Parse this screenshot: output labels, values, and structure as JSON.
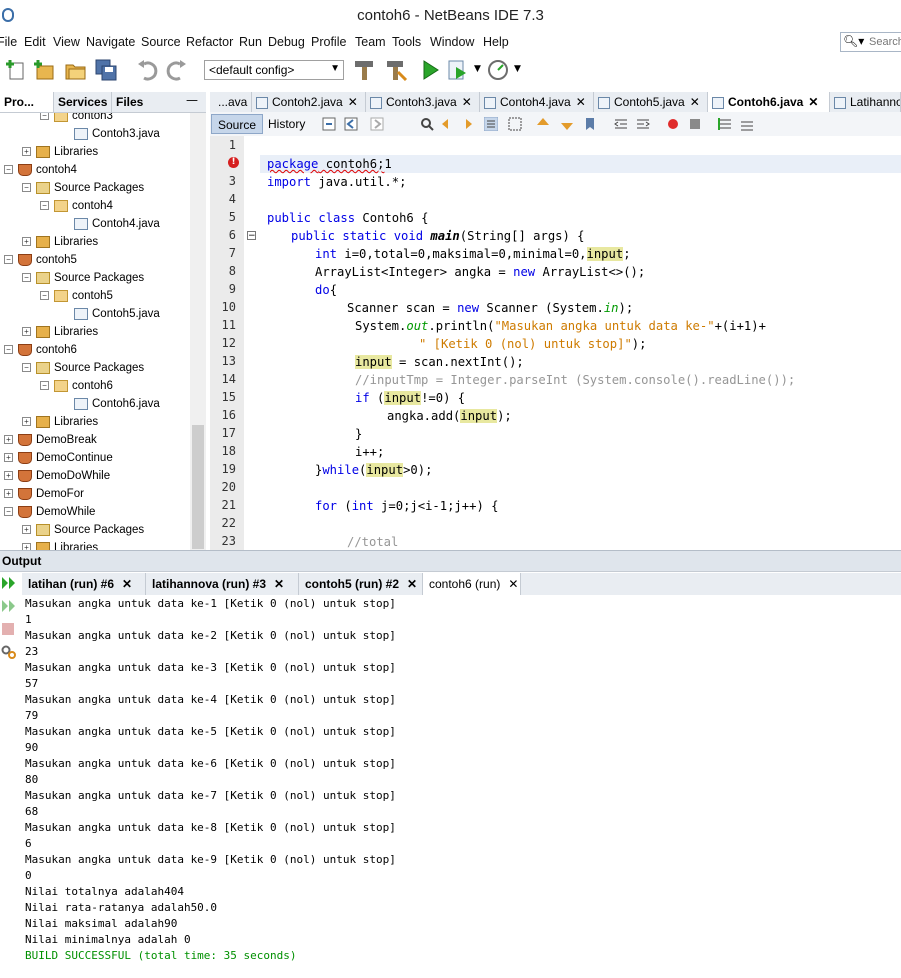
{
  "window": {
    "title": "contoh6 - NetBeans IDE 7.3"
  },
  "menubar": {
    "items": [
      "File",
      "Edit",
      "View",
      "Navigate",
      "Source",
      "Refactor",
      "Run",
      "Debug",
      "Profile",
      "Team",
      "Tools",
      "Window",
      "Help"
    ],
    "search_placeholder": "Search"
  },
  "toolbar": {
    "config": "<default config>"
  },
  "projects": {
    "tabs": [
      "Pro...",
      "Services",
      "Files"
    ],
    "minimize": "—",
    "tree": [
      {
        "label": "contoh3",
        "icon": "package-icon",
        "level": 2,
        "toggle": "−"
      },
      {
        "label": "Contoh3.java",
        "icon": "java-file-icon",
        "level": 3,
        "toggle": ""
      },
      {
        "label": "Libraries",
        "icon": "library-icon",
        "level": 1,
        "toggle": "+"
      },
      {
        "label": "contoh4",
        "icon": "project-icon",
        "level": 0,
        "toggle": "−"
      },
      {
        "label": "Source Packages",
        "icon": "source-packages-icon",
        "level": 1,
        "toggle": "−"
      },
      {
        "label": "contoh4",
        "icon": "package-icon",
        "level": 2,
        "toggle": "−"
      },
      {
        "label": "Contoh4.java",
        "icon": "java-file-icon",
        "level": 3,
        "toggle": ""
      },
      {
        "label": "Libraries",
        "icon": "library-icon",
        "level": 1,
        "toggle": "+"
      },
      {
        "label": "contoh5",
        "icon": "project-icon",
        "level": 0,
        "toggle": "−"
      },
      {
        "label": "Source Packages",
        "icon": "source-packages-icon",
        "level": 1,
        "toggle": "−"
      },
      {
        "label": "contoh5",
        "icon": "package-icon",
        "level": 2,
        "toggle": "−"
      },
      {
        "label": "Contoh5.java",
        "icon": "java-file-icon",
        "level": 3,
        "toggle": ""
      },
      {
        "label": "Libraries",
        "icon": "library-icon",
        "level": 1,
        "toggle": "+"
      },
      {
        "label": "contoh6",
        "icon": "project-icon",
        "level": 0,
        "toggle": "−"
      },
      {
        "label": "Source Packages",
        "icon": "source-packages-icon",
        "level": 1,
        "toggle": "−"
      },
      {
        "label": "contoh6",
        "icon": "package-icon",
        "level": 2,
        "toggle": "−"
      },
      {
        "label": "Contoh6.java",
        "icon": "java-file-icon",
        "level": 3,
        "toggle": ""
      },
      {
        "label": "Libraries",
        "icon": "library-icon",
        "level": 1,
        "toggle": "+"
      },
      {
        "label": "DemoBreak",
        "icon": "project-icon",
        "level": 0,
        "toggle": "+"
      },
      {
        "label": "DemoContinue",
        "icon": "project-icon",
        "level": 0,
        "toggle": "+"
      },
      {
        "label": "DemoDoWhile",
        "icon": "project-icon",
        "level": 0,
        "toggle": "+"
      },
      {
        "label": "DemoFor",
        "icon": "project-icon",
        "level": 0,
        "toggle": "+"
      },
      {
        "label": "DemoWhile",
        "icon": "project-icon",
        "level": 0,
        "toggle": "−"
      },
      {
        "label": "Source Packages",
        "icon": "source-packages-icon",
        "level": 1,
        "toggle": "+"
      },
      {
        "label": "Libraries",
        "icon": "library-icon",
        "level": 1,
        "toggle": "+"
      }
    ]
  },
  "editor": {
    "tabs": [
      {
        "label": "...ava",
        "active": false,
        "close": false
      },
      {
        "label": "Contoh2.java",
        "active": false,
        "close": true
      },
      {
        "label": "Contoh3.java",
        "active": false,
        "close": true
      },
      {
        "label": "Contoh4.java",
        "active": false,
        "close": true
      },
      {
        "label": "Contoh5.java",
        "active": false,
        "close": true
      },
      {
        "label": "Contoh6.java",
        "active": true,
        "close": true
      },
      {
        "label": "Latihannov",
        "active": false,
        "close": false
      }
    ],
    "close_glyph": "✕",
    "view_tabs": {
      "source": "Source",
      "history": "History"
    },
    "line_numbers": [
      "1",
      "2",
      "3",
      "4",
      "5",
      "6",
      "7",
      "8",
      "9",
      "10",
      "11",
      "12",
      "13",
      "14",
      "15",
      "16",
      "17",
      "18",
      "19",
      "20",
      "21",
      "22",
      "23"
    ],
    "code": {
      "l2a": "package",
      "l2b": " contoh6;",
      "l2c": "1",
      "l3a": "import",
      "l3b": " java.util.*;",
      "l5a": "public class",
      "l5b": " Contoh6 {",
      "l6a": "public static void",
      "l6b": "main",
      "l6c": "(String[] args) {",
      "l7a": "int",
      "l7b": " i=0,total=0,maksimal=0,minimal=0,",
      "l7c": "input",
      "l7d": ";",
      "l8a": "ArrayList<Integer> angka = ",
      "l8b": "new",
      "l8c": " ArrayList<>();",
      "l9a": "do",
      "l9b": "{",
      "l10a": "Scanner scan = ",
      "l10b": "new",
      "l10c": " Scanner (System.",
      "l10d": "in",
      "l10e": ");",
      "l11a": "System.",
      "l11b": "out",
      "l11c": ".println(",
      "l11d": "\"Masukan angka untuk data ke-\"",
      "l11e": "+(i+1)+",
      "l12a": "\" [Ketik 0 (nol) untuk stop]\"",
      "l12b": ");",
      "l13a": "input",
      "l13b": " = scan.nextInt();",
      "l14a": "//inputTmp = Integer.parseInt (System.console().readLine());",
      "l15a": "if",
      "l15b": " (",
      "l15c": "input",
      "l15d": "!=0) {",
      "l16a": "angka.add(",
      "l16b": "input",
      "l16c": ");",
      "l17a": "}",
      "l18a": "i++;",
      "l19a": "}",
      "l19b": "while",
      "l19c": "(",
      "l19d": "input",
      "l19e": ">0);",
      "l21a": "for",
      "l21b": " (",
      "l21c": "int",
      "l21d": " j=0;j<i-1;j++) {",
      "l23a": "//total"
    }
  },
  "output": {
    "title": "Output",
    "tabs": [
      {
        "label": "latihan (run) #6",
        "bold": true
      },
      {
        "label": "latihannova (run) #3",
        "bold": true
      },
      {
        "label": "contoh5 (run) #2",
        "bold": true
      },
      {
        "label": "contoh6 (run)",
        "bold": false
      }
    ],
    "lines": [
      "Masukan angka untuk data ke-1 [Ketik 0 (nol) untuk stop]",
      "1",
      "Masukan angka untuk data ke-2 [Ketik 0 (nol) untuk stop]",
      "23",
      "Masukan angka untuk data ke-3 [Ketik 0 (nol) untuk stop]",
      "57",
      "Masukan angka untuk data ke-4 [Ketik 0 (nol) untuk stop]",
      "79",
      "Masukan angka untuk data ke-5 [Ketik 0 (nol) untuk stop]",
      "90",
      "Masukan angka untuk data ke-6 [Ketik 0 (nol) untuk stop]",
      "80",
      "Masukan angka untuk data ke-7 [Ketik 0 (nol) untuk stop]",
      "68",
      "Masukan angka untuk data ke-8 [Ketik 0 (nol) untuk stop]",
      "6",
      "Masukan angka untuk data ke-9 [Ketik 0 (nol) untuk stop]",
      "0",
      "Nilai totalnya adalah404",
      "Nilai rata-ratanya adalah50.0",
      "Nilai maksimal adalah90",
      "Nilai minimalnya adalah 0"
    ],
    "build": "BUILD SUCCESSFUL (total time: 35 seconds)"
  },
  "colors": {
    "keyword": "#0000e6",
    "string": "#ce7b00",
    "comment": "#969696",
    "build_ok": "#009000",
    "highlight": "#e8e8a0"
  }
}
